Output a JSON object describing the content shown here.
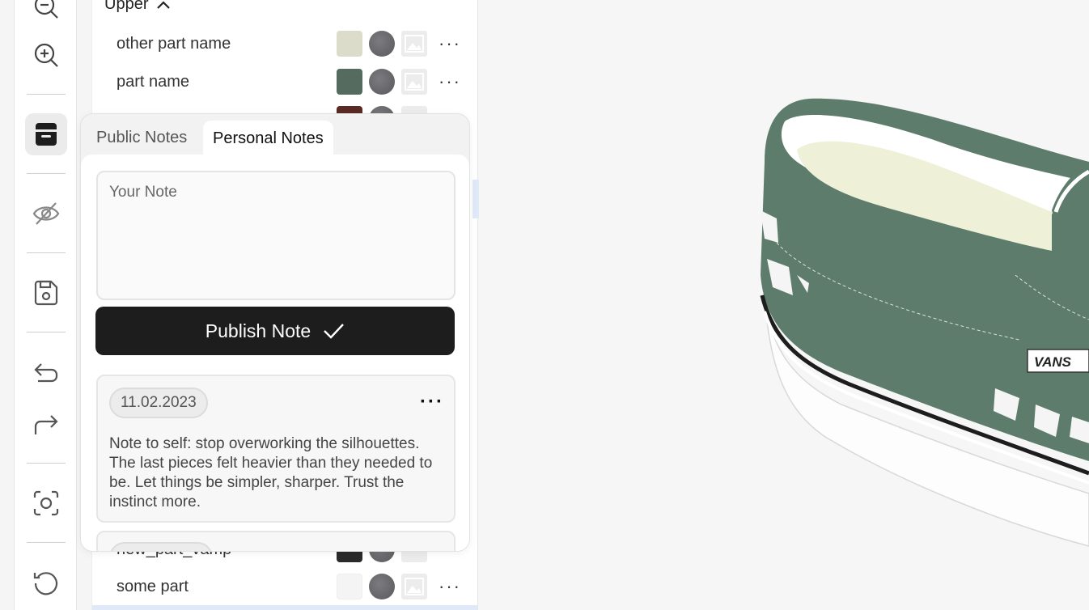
{
  "toolbar": {
    "icons": [
      "zoom-out-icon",
      "zoom-in-icon",
      "notes-icon",
      "hide-icon",
      "save-icon",
      "undo-icon",
      "redo-icon",
      "screenshot-icon",
      "reset-icon"
    ]
  },
  "parts_panel": {
    "group_label": "Upper",
    "rows": [
      {
        "name": "other part name",
        "color": "#dcdccb"
      },
      {
        "name": "part name",
        "color": "#556b5f"
      },
      {
        "name": "",
        "color": "#5a2a24"
      },
      {
        "name": "new_part_vamp",
        "color": "#2a2a2a"
      },
      {
        "name": "some part",
        "color": "#f4f4f4"
      }
    ]
  },
  "notes_popup": {
    "tabs": [
      "Public Notes",
      "Personal Notes"
    ],
    "active_tab": "Personal Notes",
    "note_placeholder": "Your Note",
    "publish_label": "Publish Note",
    "notes": [
      {
        "date": "11.02.2023",
        "text": "Note to self: stop overworking the silhouettes. The last pieces felt heavier than they needed to be. Let things be simpler, sharper. Trust the instinct more."
      },
      {
        "date": "",
        "text": ""
      }
    ]
  },
  "viewport": {
    "brand_label": "VANS",
    "shoe_color": "#5d7c6c"
  }
}
